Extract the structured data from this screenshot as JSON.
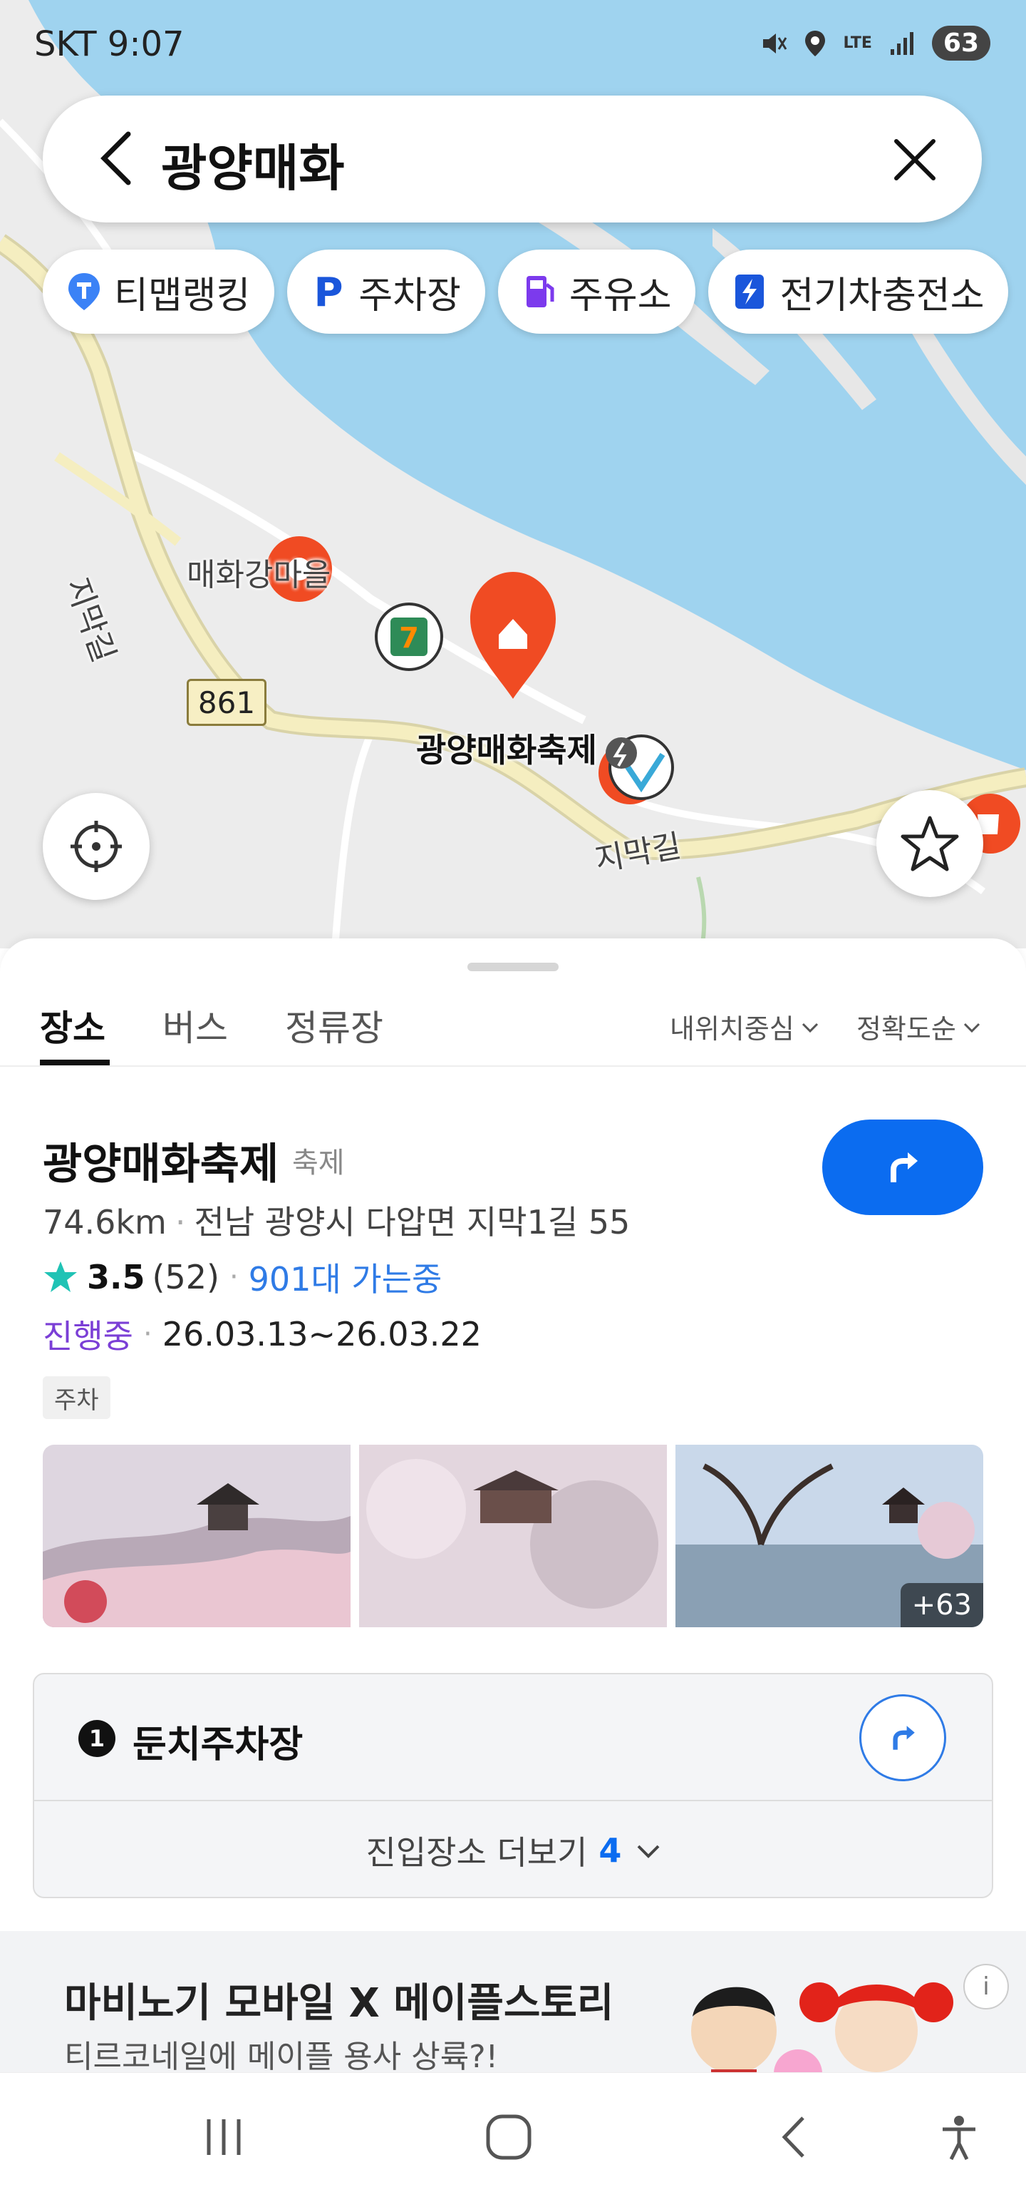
{
  "status_bar": {
    "carrier_time": "SKT 9:07",
    "icons": [
      "mute-icon",
      "location-icon",
      "lte-icon",
      "signal-icon"
    ],
    "lte_label": "LTE",
    "battery": "63"
  },
  "search": {
    "query": "광양매화"
  },
  "chips": [
    {
      "label": "티맵랭킹",
      "icon": "tmap-ranking-icon"
    },
    {
      "label": "주차장",
      "icon": "parking-icon"
    },
    {
      "label": "주유소",
      "icon": "gas-station-icon"
    },
    {
      "label": "전기차충전소",
      "icon": "ev-charger-icon"
    }
  ],
  "map": {
    "labels": {
      "village": "매화강마을",
      "festival": "광양매화축제",
      "road1": "지막길",
      "road2": "지막길",
      "route_no": "861"
    },
    "colors": {
      "water": "#9fd3ef",
      "land": "#ececec",
      "road": "#f5eec0",
      "pin": "#f04b23"
    }
  },
  "tabs": {
    "items": [
      "장소",
      "버스",
      "정류장"
    ],
    "active": "장소",
    "sort1": "내위치중심",
    "sort2": "정확도순"
  },
  "place": {
    "name": "광양매화축제",
    "category": "축제",
    "distance": "74.6km",
    "address": "전남 광양시 다압면 지막1길 55",
    "rating": "3.5",
    "rating_count": "(52)",
    "going": "901대 가는중",
    "status": "진행중",
    "dates": "26.03.13~26.03.22",
    "tag": "주차",
    "more_photos": "+63"
  },
  "entry": {
    "number": "1",
    "name": "둔치주차장",
    "more_label": "진입장소 더보기",
    "more_count": "4"
  },
  "ad": {
    "title": "마비노기 모바일 X 메이플스토리",
    "subtitle": "티르코네일에 메이플 용사 상륙?!",
    "info": "i"
  }
}
